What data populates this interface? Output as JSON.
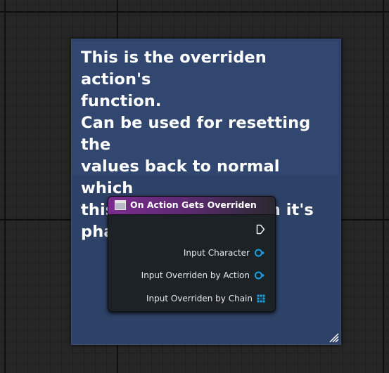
{
  "comment": {
    "text": "This is the overriden action's\nfunction.\nCan be used for resetting the\nvalues back to normal which\nthis action changed in it's\nphases.",
    "colors": {
      "body": "#2e4166",
      "header": "#32476f"
    }
  },
  "event_node": {
    "title": "On Action Gets Overriden",
    "header_color": "#7a2c8e",
    "icon": "event-node-icon",
    "pins": [
      {
        "label": "",
        "type": "exec",
        "icon": "exec-output-pin-icon"
      },
      {
        "label": "Input Character",
        "type": "object",
        "icon": "object-output-pin-icon",
        "color": "#1aa0e6"
      },
      {
        "label": "Input Overriden by Action",
        "type": "object",
        "icon": "object-output-pin-icon",
        "color": "#1aa0e6"
      },
      {
        "label": "Input Overriden by Chain",
        "type": "array",
        "icon": "array-output-pin-icon",
        "color": "#1aa0e6"
      }
    ]
  },
  "canvas": {
    "background": "#262626",
    "icon": "resize-handle-icon"
  }
}
